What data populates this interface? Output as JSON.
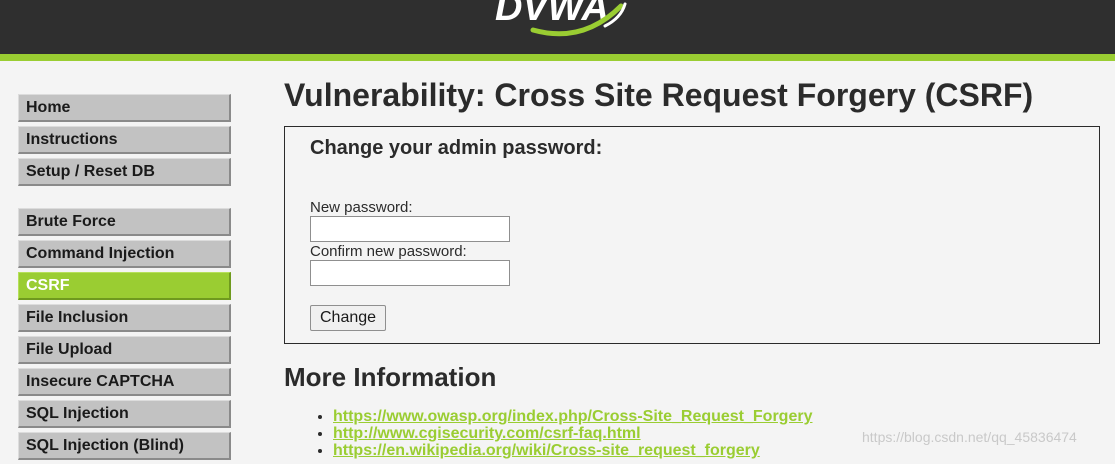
{
  "header": {
    "logo_text": "DVWA",
    "colors": {
      "background": "#2f2f2f",
      "accent": "#9acd32"
    }
  },
  "sidebar": {
    "groups": [
      {
        "items": [
          {
            "label": "Home"
          },
          {
            "label": "Instructions"
          },
          {
            "label": "Setup / Reset DB"
          }
        ]
      },
      {
        "items": [
          {
            "label": "Brute Force"
          },
          {
            "label": "Command Injection"
          },
          {
            "label": "CSRF",
            "selected": true
          },
          {
            "label": "File Inclusion"
          },
          {
            "label": "File Upload"
          },
          {
            "label": "Insecure CAPTCHA"
          },
          {
            "label": "SQL Injection"
          },
          {
            "label": "SQL Injection (Blind)"
          }
        ]
      }
    ]
  },
  "main": {
    "title": "Vulnerability: Cross Site Request Forgery (CSRF)",
    "form": {
      "heading": "Change your admin password:",
      "new_password_label": "New password:",
      "new_password_value": "",
      "confirm_password_label": "Confirm new password:",
      "confirm_password_value": "",
      "submit_label": "Change"
    },
    "more_info": {
      "heading": "More Information",
      "links": [
        "https://www.owasp.org/index.php/Cross-Site_Request_Forgery",
        "http://www.cgisecurity.com/csrf-faq.html",
        "https://en.wikipedia.org/wiki/Cross-site_request_forgery"
      ]
    }
  },
  "watermark": "https://blog.csdn.net/qq_45836474"
}
